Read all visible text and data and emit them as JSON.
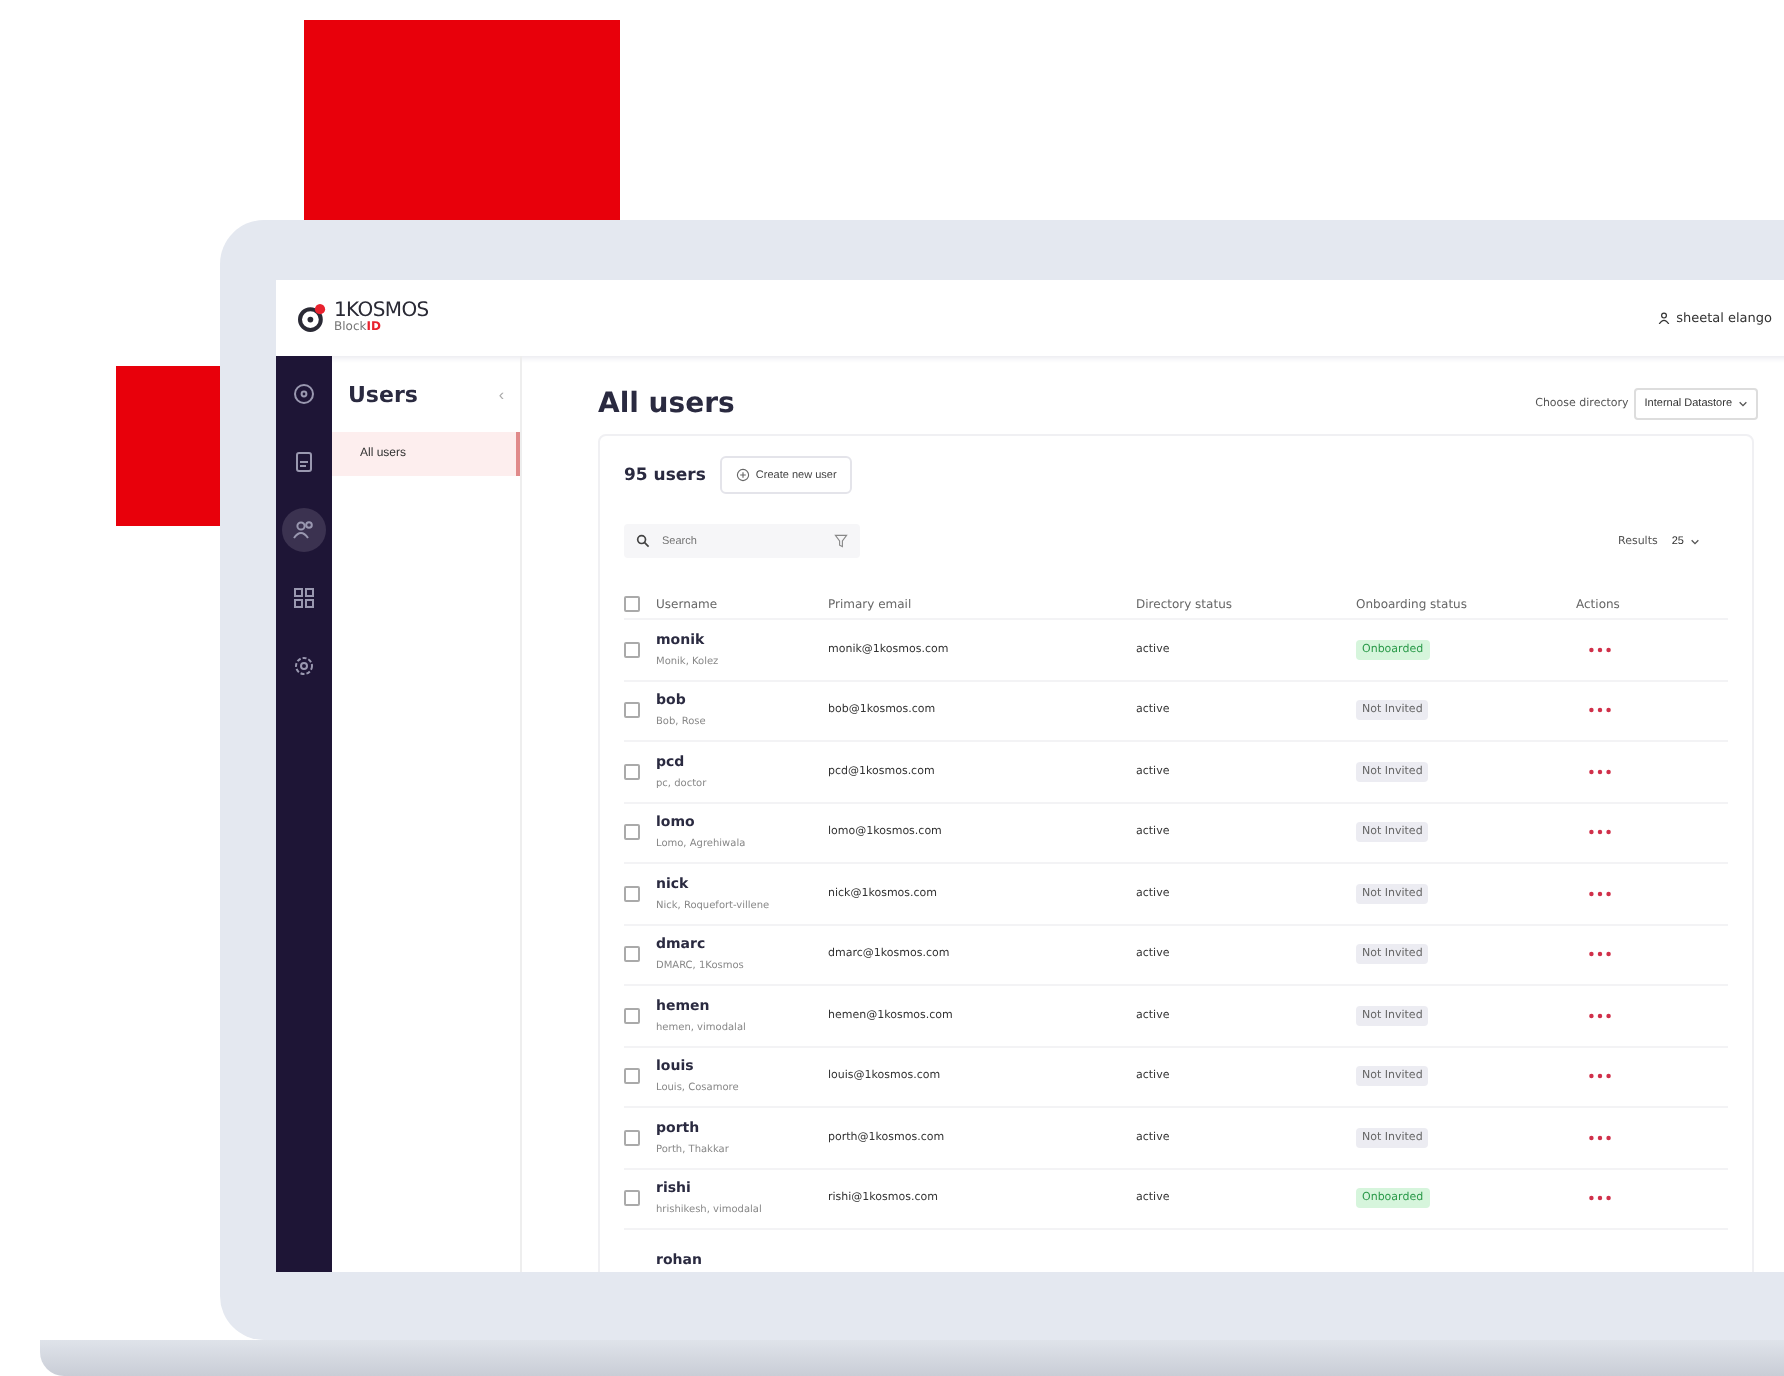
{
  "brand": {
    "name": "1KOSMOS",
    "sub_plain": "Block",
    "sub_accent": "ID"
  },
  "user": {
    "name": "sheetal elango"
  },
  "nav": [
    {
      "selected": false
    },
    {
      "selected": false
    },
    {
      "selected": true
    },
    {
      "selected": false
    },
    {
      "selected": false
    }
  ],
  "panel": {
    "title": "Users",
    "collapse": "‹",
    "items": [
      {
        "label": "All users",
        "selected": true
      }
    ]
  },
  "page": {
    "title": "All users",
    "directory_label": "Choose directory",
    "directory_value": "Internal Datastore"
  },
  "toolbar": {
    "count": "95 users",
    "create_button": "Create new user",
    "search_placeholder": "Search",
    "results_label": "Results",
    "results_value": "25"
  },
  "table": {
    "select_all_checked": false,
    "columns": [
      "Username",
      "Primary email",
      "Directory status",
      "Onboarding status",
      "Actions"
    ],
    "rows": [
      {
        "username": "monik",
        "full_name": "Monik, Kolez",
        "email": "monik@1kosmos.com",
        "directory_status": "active",
        "onboarding": "Onboarded",
        "kind": "onboarded",
        "checked": false
      },
      {
        "username": "bob",
        "full_name": "Bob, Rose",
        "email": "bob@1kosmos.com",
        "directory_status": "active",
        "onboarding": "Not Invited",
        "kind": "not_invited",
        "checked": false
      },
      {
        "username": "pcd",
        "full_name": "pc, doctor",
        "email": "pcd@1kosmos.com",
        "directory_status": "active",
        "onboarding": "Not Invited",
        "kind": "not_invited",
        "checked": false
      },
      {
        "username": "lomo",
        "full_name": "Lomo, Agrehiwala",
        "email": "lomo@1kosmos.com",
        "directory_status": "active",
        "onboarding": "Not Invited",
        "kind": "not_invited",
        "checked": false
      },
      {
        "username": "nick",
        "full_name": "Nick, Roquefort-villene",
        "email": "nick@1kosmos.com",
        "directory_status": "active",
        "onboarding": "Not Invited",
        "kind": "not_invited",
        "checked": false
      },
      {
        "username": "dmarc",
        "full_name": "DMARC, 1Kosmos",
        "email": "dmarc@1kosmos.com",
        "directory_status": "active",
        "onboarding": "Not Invited",
        "kind": "not_invited",
        "checked": false
      },
      {
        "username": "hemen",
        "full_name": "hemen, vimodalal",
        "email": "hemen@1kosmos.com",
        "directory_status": "active",
        "onboarding": "Not Invited",
        "kind": "not_invited",
        "checked": false
      },
      {
        "username": "louis",
        "full_name": "Louis, Cosamore",
        "email": "louis@1kosmos.com",
        "directory_status": "active",
        "onboarding": "Not Invited",
        "kind": "not_invited",
        "checked": false
      },
      {
        "username": "porth",
        "full_name": "Porth, Thakkar",
        "email": "porth@1kosmos.com",
        "directory_status": "active",
        "onboarding": "Not Invited",
        "kind": "not_invited",
        "checked": false
      },
      {
        "username": "rishi",
        "full_name": "hrishikesh, vimodalal",
        "email": "rishi@1kosmos.com",
        "directory_status": "active",
        "onboarding": "Onboarded",
        "kind": "onboarded",
        "checked": false
      }
    ],
    "partial_row": {
      "username": "rohan"
    }
  }
}
